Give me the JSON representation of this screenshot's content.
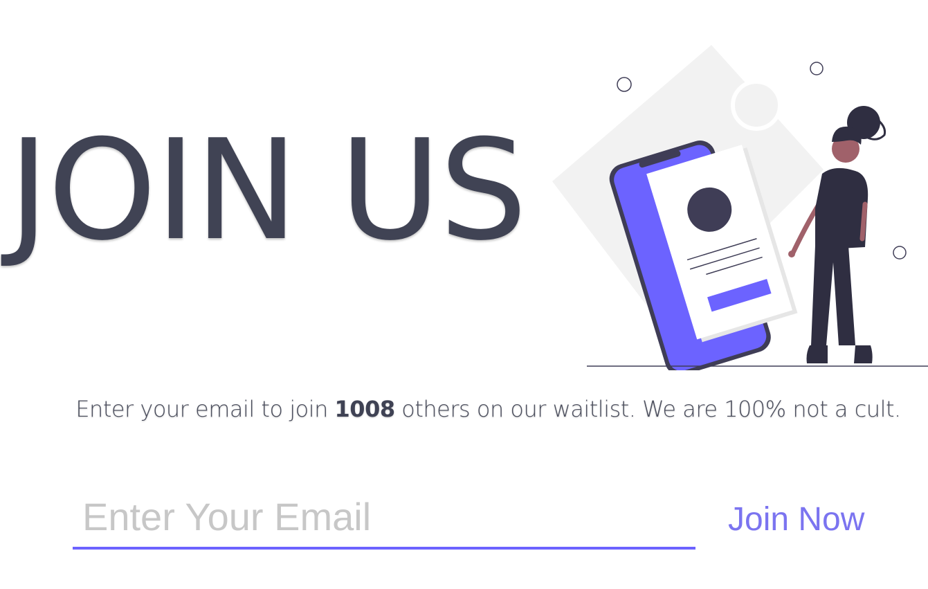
{
  "hero": {
    "title": "JOIN US",
    "title_color": "#404354"
  },
  "waitlist": {
    "text_before": "Enter your email to join ",
    "count": "1008",
    "text_after": " others on our waitlist. We are 100% not a cult."
  },
  "form": {
    "email_placeholder": "Enter Your Email",
    "join_label": "Join Now",
    "join_color": "#7b74f0",
    "accent": "#6c63ff"
  },
  "illustration": {
    "icon": "woman-with-phone-signup-illustration",
    "phone_color": "#6c63ff",
    "figure_color": "#2f2e41"
  }
}
